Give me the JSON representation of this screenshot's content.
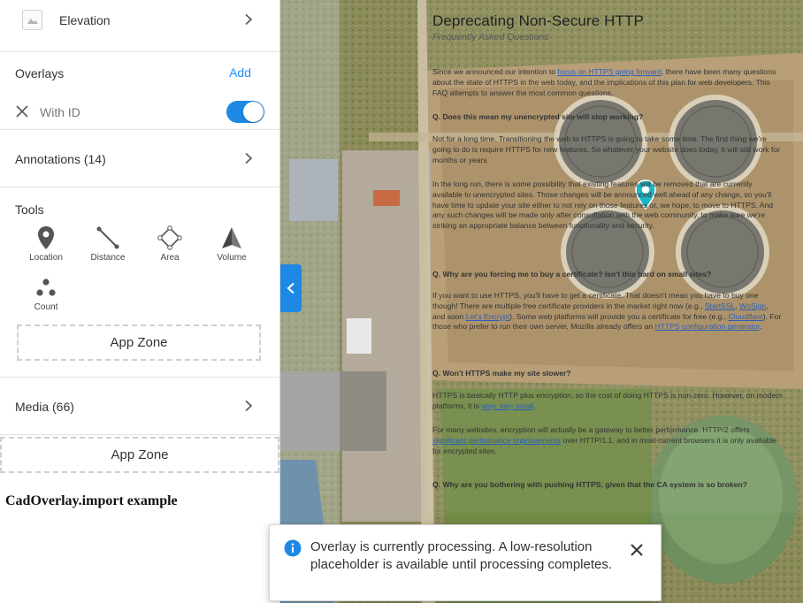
{
  "sidebar": {
    "elevation_label": "Elevation",
    "overlays_label": "Overlays",
    "overlays_add": "Add",
    "overlay_item_label": "With ID",
    "overlay_item_enabled": true,
    "annotations_label": "Annotations (14)",
    "tools_label": "Tools",
    "tools": [
      {
        "label": "Location",
        "icon": "location-pin-icon"
      },
      {
        "label": "Distance",
        "icon": "distance-ruler-icon"
      },
      {
        "label": "Area",
        "icon": "area-polygon-icon"
      },
      {
        "label": "Volume",
        "icon": "volume-cone-icon"
      },
      {
        "label": "Count",
        "icon": "count-dots-icon"
      }
    ],
    "app_zone_1": "App Zone",
    "media_label": "Media (66)",
    "app_zone_2": "App Zone",
    "example_title": "CadOverlay.import example"
  },
  "overlay_doc": {
    "title": "Deprecating Non-Secure HTTP",
    "subtitle": "Frequently Asked Questions",
    "intro_a": "Since we announced our intention to ",
    "intro_link": "focus on HTTPS going forward",
    "intro_b": ", there have been many questions about the state of HTTPS in the web today, and the implications of this plan for web developers.  This FAQ attempts to answer the most common questions.",
    "q1": "Q. Does this mean my unencrypted site will stop working?",
    "a1": "Not for a long time.  Transitioning the web to HTTPS is going to take some time.  The first thing we're going to do is require HTTPS for new features.  So whatever your website does today, it will still work for months or years.",
    "a1b": "In the long run, there is some possibility that existing features will be removed that are currently available to unencrypted sites.  Those changes will be announced well ahead of any change, so you'll have time to update your site either to not rely on those features or, we hope, to move to HTTPS.  And any such changes will be made only after consultation with the web community, to make sure we're striking an appropriate balance between functionality and security.",
    "q2": "Q. Why are you forcing me to buy a certificate?  Isn't this hard on small sites?",
    "a2_a": "If you want to use HTTPS, you'll have to get a certificate.  That doesn't mean you have to buy one though!  There are multiple free certificate providers in the market right now (e.g., ",
    "a2_link1": "StartSSL",
    "a2_sep": ", ",
    "a2_link2": "WoSign",
    "a2_b": ", and soon ",
    "a2_link3": "Let's Encrypt",
    "a2_c": ").  Some web platforms will provide you a certificate for free (e.g., ",
    "a2_link4": "Cloudflare",
    "a2_d": ").  For those who prefer to run their own server, Mozilla already offers an ",
    "a2_link5": "HTTPS configuration generator",
    "a2_e": ".",
    "q3": "Q. Won't HTTPS make my site slower?",
    "a3_a": "HTTPS is basically HTTP plus encryption, so the cost of doing HTTPS is non-zero.  However, on modern platforms, it is ",
    "a3_link": "very, very small",
    "a3_b": ".",
    "a3b_a": "For many websites, encryption will actually be a gateway to better performance.  HTTP/2 offers ",
    "a3b_link": "significant performance improvements",
    "a3b_b": " over HTTP/1.1, and in most current browsers it is only available for encrypted sites.",
    "q4": "Q. Why are you bothering with pushing HTTPS, given that the CA system is so broken?"
  },
  "toast": {
    "message": "Overlay is currently processing. A low-resolution placeholder is available until processing completes."
  },
  "colors": {
    "accent": "#1e88e5",
    "link": "#1e90ff"
  }
}
